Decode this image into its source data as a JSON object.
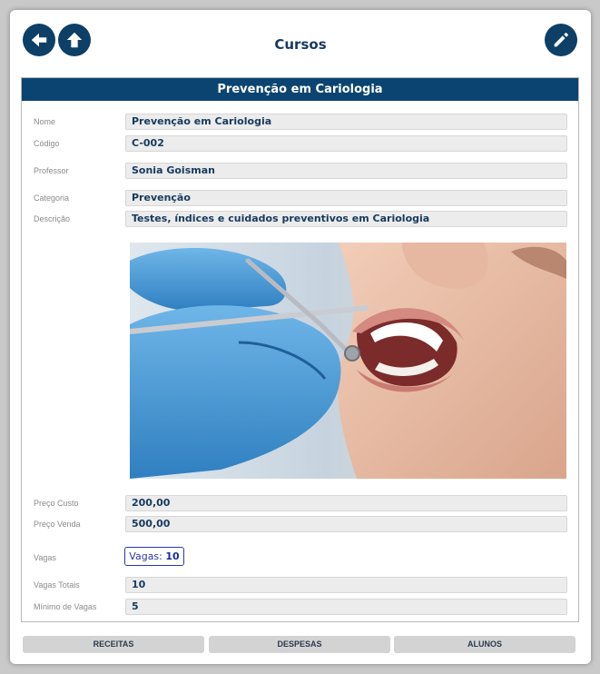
{
  "header": {
    "title": "Cursos",
    "back_icon": "arrow-left-icon",
    "home_icon": "arrow-up-icon",
    "edit_icon": "pencil-icon"
  },
  "course": {
    "heading": "Prevenção em Cariologia",
    "fields": [
      {
        "label": "Nome",
        "value": "Prevenção em Cariologia"
      },
      {
        "label": "Código",
        "value": "C-002"
      },
      {
        "label": "Professor",
        "value": "Sonia Goisman"
      },
      {
        "label": "Categoria",
        "value": "Prevenção"
      },
      {
        "label": "Descrição",
        "value": "Testes, índices e cuidados preventivos em Cariologia"
      }
    ],
    "prices": [
      {
        "label": "Preço Custo",
        "value": "200,00"
      },
      {
        "label": "Preço Venda",
        "value": "500,00"
      }
    ],
    "vagas": {
      "label": "Vagas",
      "badge_prefix": "Vagas:",
      "badge_value": "10"
    },
    "capacity": [
      {
        "label": "Vagas Totais",
        "value": "10"
      },
      {
        "label": "Mínimo de Vagas",
        "value": "5"
      }
    ]
  },
  "footer": {
    "receitas": "RECEITAS",
    "despesas": "DESPESAS",
    "alunos": "ALUNOS"
  },
  "colors": {
    "primary": "#0b4470",
    "field_bg": "#ececec",
    "badge": "#2a3aa8"
  }
}
